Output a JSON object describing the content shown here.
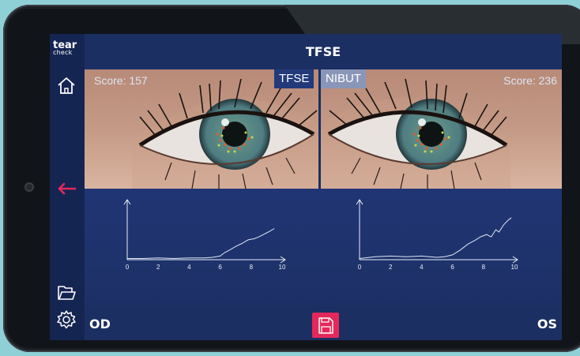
{
  "app": {
    "logo_line1": "tear",
    "logo_line2": "check",
    "title": "TFSE"
  },
  "sidebar": {
    "items": [
      {
        "name": "home",
        "icon": "home-icon"
      },
      {
        "name": "back",
        "icon": "arrow-left-icon"
      },
      {
        "name": "folder",
        "icon": "folder-icon"
      },
      {
        "name": "settings",
        "icon": "gear-icon"
      }
    ]
  },
  "eyes": {
    "left": {
      "score_label": "Score: 157",
      "score": 157
    },
    "right": {
      "score_label": "Score: 236",
      "score": 236
    }
  },
  "tabs": [
    {
      "label": "TFSE",
      "selected": true
    },
    {
      "label": "NIBUT",
      "selected": false
    }
  ],
  "footer": {
    "left_label": "OD",
    "right_label": "OS",
    "save_icon": "save-icon"
  },
  "colors": {
    "background": "#8fd0d6",
    "screen": "#1c2f63",
    "sidebar": "#152552",
    "accent": "#e5285b",
    "tab_selected": "#223a7a",
    "tab_unselected": "#8a96b8"
  },
  "chart_data": [
    {
      "type": "line",
      "title": "",
      "xlabel": "",
      "ylabel": "",
      "xlim": [
        0,
        10
      ],
      "xticks": [
        "0",
        "2",
        "4",
        "6",
        "8",
        "10"
      ],
      "grid": false,
      "series": [
        {
          "x": [
            0,
            1,
            2,
            3,
            4,
            5,
            5.5,
            6,
            6.3,
            6.6,
            7,
            7.4,
            7.8,
            8.2,
            8.5,
            8.8,
            9.1,
            9.5
          ],
          "y": [
            0.02,
            0.02,
            0.03,
            0.02,
            0.03,
            0.03,
            0.04,
            0.06,
            0.12,
            0.16,
            0.22,
            0.27,
            0.33,
            0.35,
            0.38,
            0.42,
            0.46,
            0.52
          ]
        }
      ]
    },
    {
      "type": "line",
      "title": "",
      "xlabel": "",
      "ylabel": "",
      "xlim": [
        0,
        10
      ],
      "xticks": [
        "0",
        "2",
        "4",
        "6",
        "8",
        "10"
      ],
      "grid": false,
      "series": [
        {
          "x": [
            0,
            1,
            2,
            3,
            4,
            5,
            5.5,
            6,
            6.5,
            7,
            7.5,
            7.8,
            8.2,
            8.5,
            8.8,
            9,
            9.3,
            9.6,
            9.8
          ],
          "y": [
            0.02,
            0.05,
            0.06,
            0.05,
            0.06,
            0.04,
            0.05,
            0.08,
            0.16,
            0.26,
            0.33,
            0.38,
            0.42,
            0.38,
            0.5,
            0.46,
            0.58,
            0.66,
            0.7
          ]
        }
      ]
    }
  ]
}
